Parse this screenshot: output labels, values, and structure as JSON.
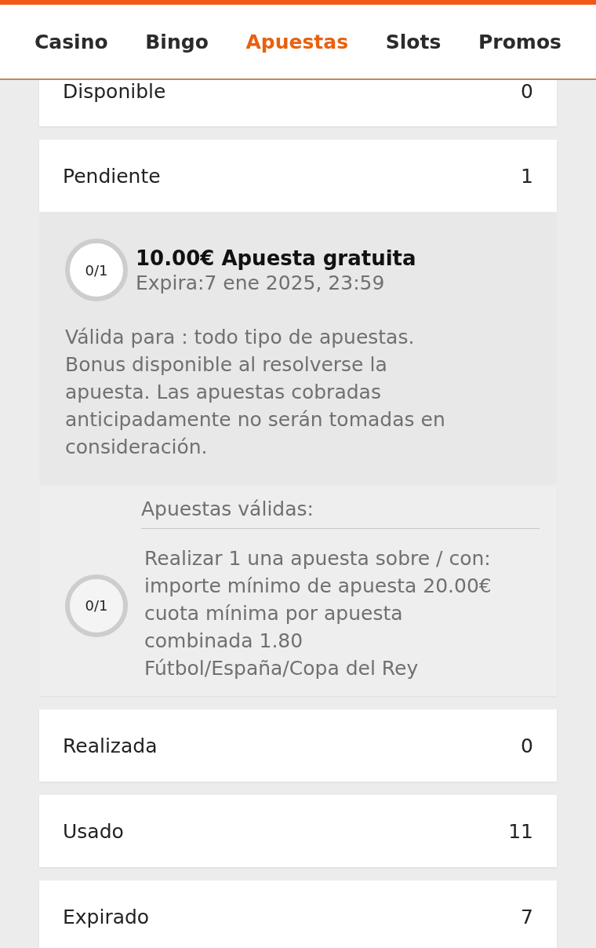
{
  "nav": {
    "tabs": [
      {
        "label": "Casino",
        "selected": false
      },
      {
        "label": "Bingo",
        "selected": false
      },
      {
        "label": "Apuestas",
        "selected": true
      },
      {
        "label": "Slots",
        "selected": false
      },
      {
        "label": "Promos",
        "selected": false
      }
    ]
  },
  "sections": [
    {
      "label": "Disponible",
      "count": "0"
    },
    {
      "label": "Pendiente",
      "count": "1",
      "bonus": {
        "progress": "0/1",
        "title": "10.00€ Apuesta gratuita",
        "expiry": "Expira:7 ene 2025, 23:59",
        "description": "Válida para : todo tipo de apuestas. Bonus disponible al resolverse la apuesta. Las apuestas cobradas anticipadamente no serán tomadas en consideración.",
        "requirement": {
          "heading": "Apuestas válidas:",
          "progress": "0/1",
          "text": "Realizar 1 una apuesta sobre / con: importe mínimo de apuesta 20.00€ cuota mínima por apuesta combinada 1.80",
          "path": "Fútbol/España/Copa del Rey"
        }
      }
    },
    {
      "label": "Realizada",
      "count": "0"
    },
    {
      "label": "Usado",
      "count": "11"
    },
    {
      "label": "Expirado",
      "count": "7"
    }
  ]
}
